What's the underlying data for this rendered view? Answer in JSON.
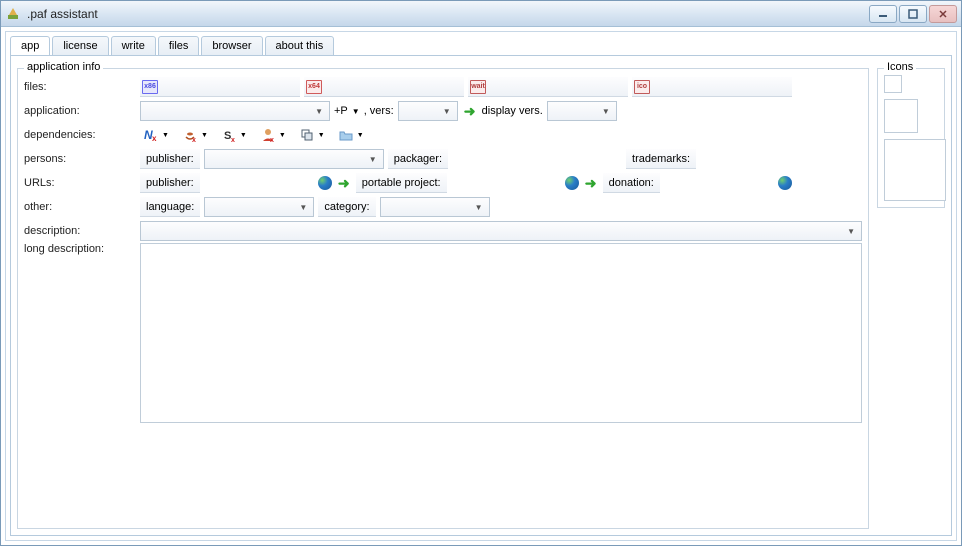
{
  "window": {
    "title": ".paf assistant"
  },
  "tabs": [
    {
      "id": "app",
      "label": "app"
    },
    {
      "id": "license",
      "label": "license"
    },
    {
      "id": "write",
      "label": "write"
    },
    {
      "id": "files",
      "label": "files"
    },
    {
      "id": "browser",
      "label": "browser"
    },
    {
      "id": "about",
      "label": "about this"
    }
  ],
  "app_panel": {
    "legend": "application info",
    "files_label": "files:",
    "file_icons": {
      "x86": "x86",
      "x64": "x64",
      "wait": "wait",
      "ico": "ico"
    },
    "application_label": "application:",
    "plusP": "+P",
    "vers_label": ", vers:",
    "display_vers_label": "display vers.",
    "dependencies_label": "dependencies:",
    "persons_label": "persons:",
    "publisher_label": "publisher:",
    "packager_label": "packager:",
    "trademarks_label": "trademarks:",
    "urls_label": "URLs:",
    "url_publisher_label": "publisher:",
    "portable_project_label": "portable project:",
    "donation_label": "donation:",
    "other_label": "other:",
    "language_label": "language:",
    "category_label": "category:",
    "description_label": "description:",
    "long_desc_label": "long description:"
  },
  "icons_panel": {
    "legend": "Icons"
  }
}
